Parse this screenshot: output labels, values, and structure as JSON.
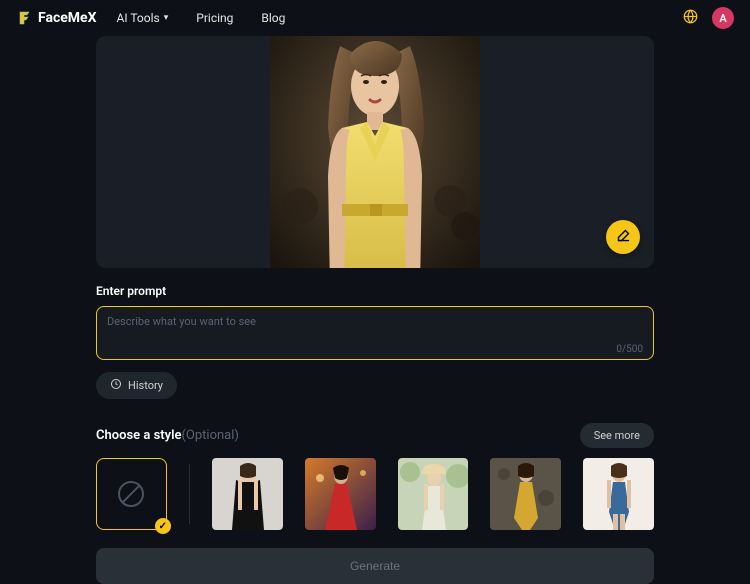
{
  "header": {
    "brand": "FaceMeX",
    "nav": {
      "ai_tools": "AI Tools",
      "pricing": "Pricing",
      "blog": "Blog"
    },
    "avatar_initial": "A"
  },
  "prompt": {
    "label": "Enter prompt",
    "placeholder": "Describe what you want to see",
    "value": "",
    "counter": "0/500"
  },
  "history_label": "History",
  "style": {
    "title": "Choose a style",
    "optional": "(Optional)",
    "see_more": "See more",
    "selected_index": 0,
    "thumbs": [
      {
        "id": "none"
      },
      {
        "id": "black-dress"
      },
      {
        "id": "red-dress-city"
      },
      {
        "id": "green-dress-garden"
      },
      {
        "id": "gold-dress-wall"
      },
      {
        "id": "blue-dress-white"
      }
    ]
  },
  "generate_label": "Generate",
  "colors": {
    "accent": "#f5c518",
    "avatar": "#d63864"
  }
}
